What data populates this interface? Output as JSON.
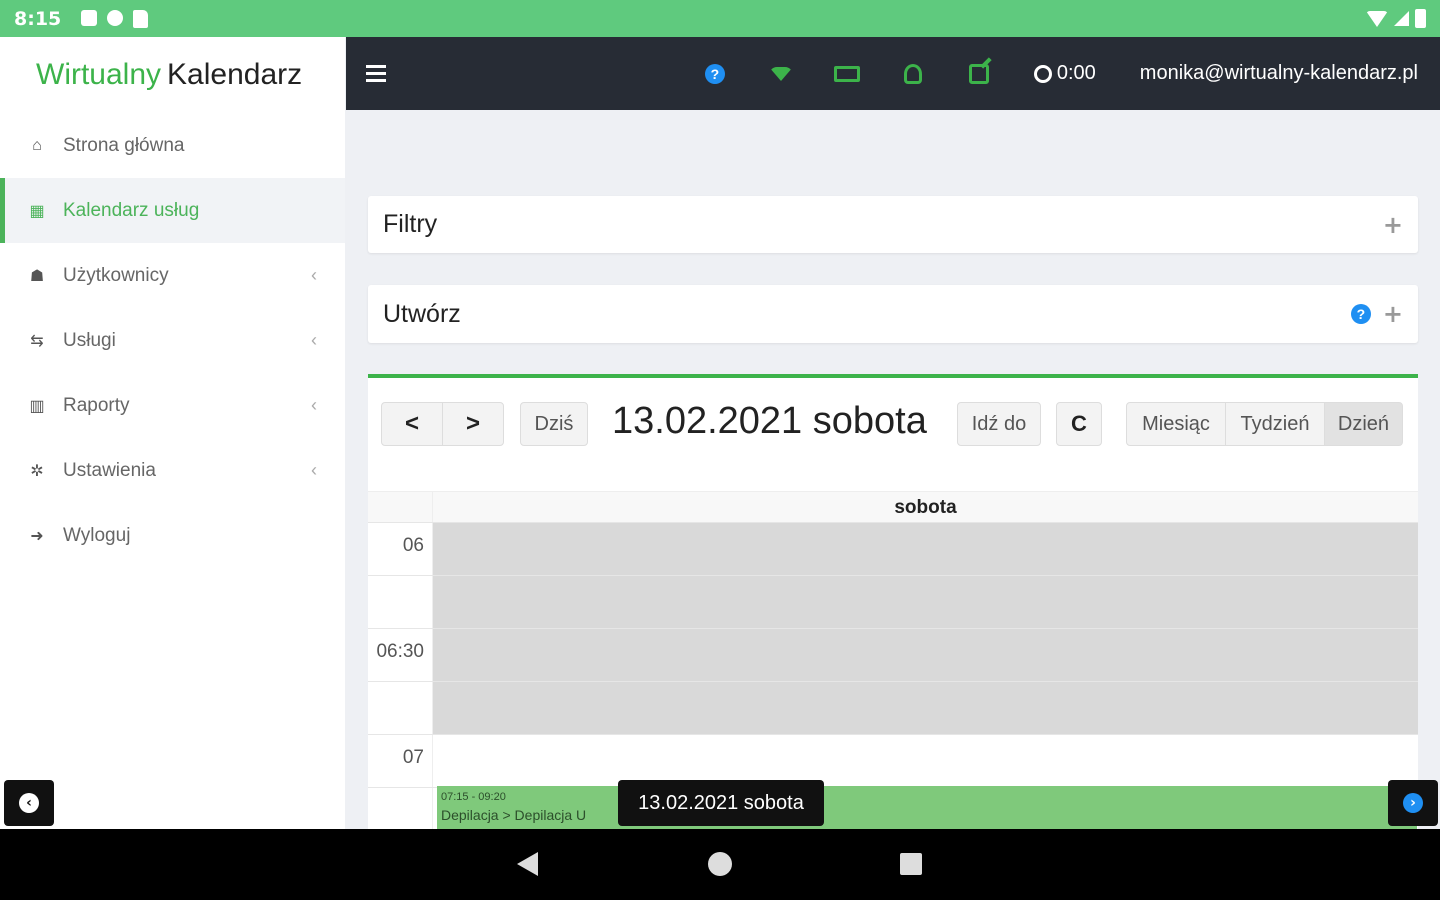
{
  "status_bar": {
    "time": "8:15"
  },
  "sidebar": {
    "logo_part1": "Wirtualny",
    "logo_part2": "Kalendarz",
    "items": [
      {
        "label": "Strona główna",
        "icon": "home-icon",
        "glyph": "⌂",
        "active": false,
        "has_caret": false
      },
      {
        "label": "Kalendarz usług",
        "icon": "calendar-icon",
        "glyph": "▦",
        "active": true,
        "has_caret": false
      },
      {
        "label": "Użytkownicy",
        "icon": "user-icon",
        "glyph": "☗",
        "active": false,
        "has_caret": true
      },
      {
        "label": "Usługi",
        "icon": "retweet-icon",
        "glyph": "⇆",
        "active": false,
        "has_caret": true
      },
      {
        "label": "Raporty",
        "icon": "bar-chart-icon",
        "glyph": "▥",
        "active": false,
        "has_caret": true
      },
      {
        "label": "Ustawienia",
        "icon": "gear-icon",
        "glyph": "✲",
        "active": false,
        "has_caret": true
      },
      {
        "label": "Wyloguj",
        "icon": "sign-out-icon",
        "glyph": "➜",
        "active": false,
        "has_caret": false
      }
    ],
    "caret": "‹"
  },
  "topbar": {
    "timer": "0:00",
    "email": "monika@wirtualny-kalendarz.pl",
    "help_glyph": "?"
  },
  "panels": {
    "filters_title": "Filtry",
    "create_title": "Utwórz",
    "plus": "+",
    "help_glyph": "?"
  },
  "calendar": {
    "prev": "<",
    "next": ">",
    "today": "Dziś",
    "title": "13.02.2021 sobota",
    "goto": "Idź do",
    "refresh": "C",
    "view_month": "Miesiąc",
    "view_week": "Tydzień",
    "view_day": "Dzień",
    "active_view": "Dzień",
    "day_header": "sobota",
    "slots": [
      {
        "label": "06",
        "off": true
      },
      {
        "label": "",
        "off": true
      },
      {
        "label": "06:30",
        "off": true
      },
      {
        "label": "",
        "off": true
      },
      {
        "label": "07",
        "off": false
      },
      {
        "label": "",
        "off": false
      }
    ],
    "event": {
      "time": "07:15 - 09:20",
      "title": "Depilacja > Depilacja U"
    }
  },
  "overlay": {
    "date_label": "13.02.2021 sobota",
    "left_arrow": "‹",
    "right_arrow": "›"
  },
  "colors": {
    "brand_green": "#3cb34a",
    "status_bar": "#5fca7e",
    "topbar": "#272c35",
    "event_bg": "#7fc97b",
    "help_blue": "#1f8ff2"
  }
}
